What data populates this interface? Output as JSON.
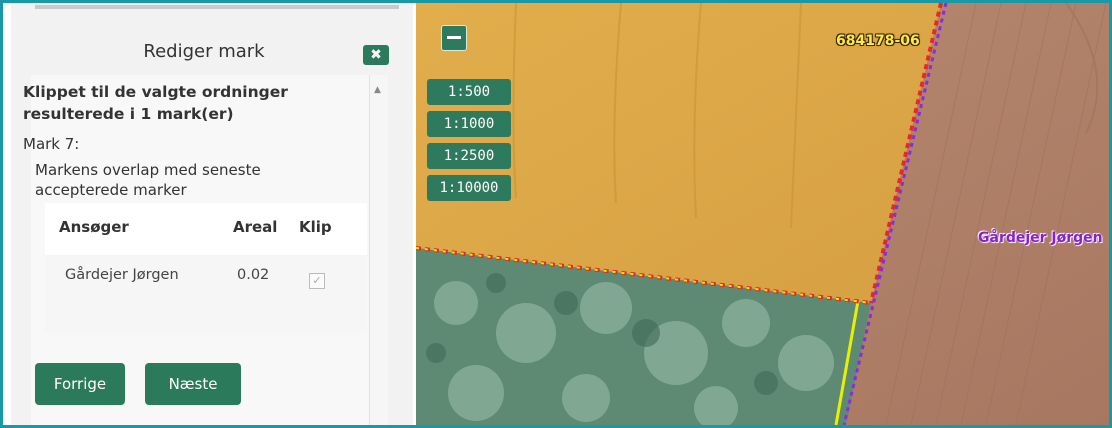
{
  "panel": {
    "title": "Rediger mark",
    "close_icon": "close-icon",
    "message": "Klippet til de valgte ordninger resulterede i 1 mark(er)",
    "mark_label": "Mark 7:",
    "overlap_text": "Markens overlap med seneste accepterede marker",
    "table": {
      "headers": [
        "Ansøger",
        "Areal",
        "Klip"
      ],
      "rows": [
        {
          "ansoeger": "Gårdejer Jørgen",
          "areal": "0.02",
          "klip_checked": true
        }
      ]
    },
    "buttons": {
      "prev": "Forrige",
      "next": "Næste"
    }
  },
  "map": {
    "zoom_out_icon": "minus-icon",
    "scales": [
      "1:500",
      "1:1000",
      "1:2500",
      "1:10000"
    ],
    "parcel_label": "684178-06",
    "owner_label": "Gårdejer Jørgen"
  },
  "colors": {
    "accent_green": "#2c7a5c",
    "frame_teal": "#1a98a6",
    "parcel_line_red": "#e22a2a",
    "overlap_line_purple": "#8a2be2",
    "boundary_yellow": "#e8f000"
  }
}
